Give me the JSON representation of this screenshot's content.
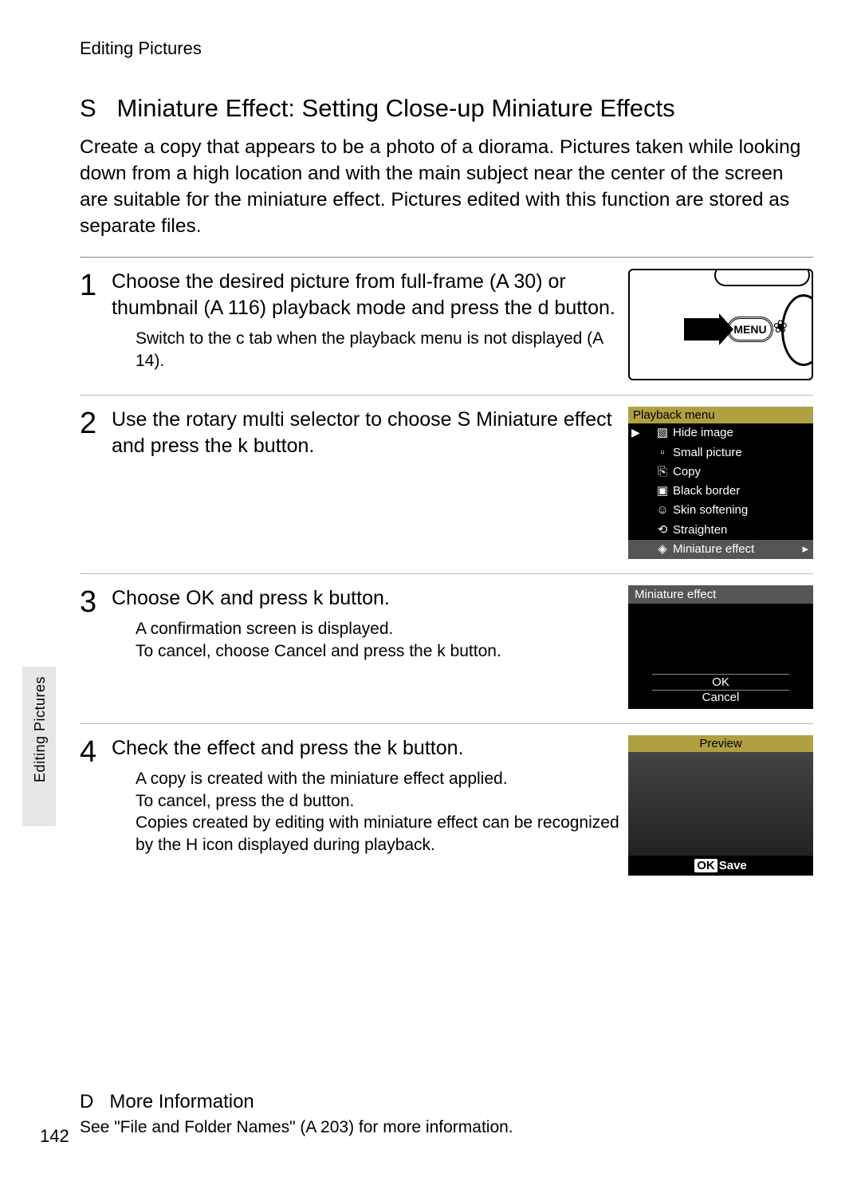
{
  "header": {
    "section": "Editing Pictures"
  },
  "side_tab": "Editing Pictures",
  "title_prefix": "S",
  "title": "Miniature Effect: Setting Close-up Miniature Effects",
  "intro": "Create a copy that appears to be a photo of a diorama. Pictures taken while looking down from a high location and with the main subject near the center of the screen are suitable for the miniature effect. Pictures edited with this function are stored as separate files.",
  "steps": [
    {
      "num": "1",
      "head": "Choose the desired picture from full-frame (A 30) or thumbnail (A 116) playback mode and press the d button.",
      "sub": "Switch to the c tab when the playback menu is not displayed (A 14).",
      "fig": "camera"
    },
    {
      "num": "2",
      "head": "Use the rotary multi selector to choose S Miniature effect and press the k button.",
      "sub": "",
      "fig": "menu"
    },
    {
      "num": "3",
      "head": "Choose OK and press k button.",
      "sub": "A confirmation screen is displayed.\nTo cancel, choose Cancel and press the k button.",
      "fig": "confirm"
    },
    {
      "num": "4",
      "head": "Check the effect and press the k button.",
      "sub": "A copy is created with the miniature effect applied.\nTo cancel, press the d button.\nCopies created by editing with miniature effect can be recognized by the H icon displayed during playback.",
      "fig": "preview"
    }
  ],
  "playback_menu": {
    "title": "Playback menu",
    "items": [
      "Hide image",
      "Small picture",
      "Copy",
      "Black border",
      "Skin softening",
      "Straighten",
      "Miniature effect"
    ],
    "selected_index": 6
  },
  "confirm_screen": {
    "title": "Miniature effect",
    "ok": "OK",
    "cancel": "Cancel"
  },
  "preview_screen": {
    "title": "Preview",
    "save": "Save",
    "ok_badge": "OK"
  },
  "camera_labels": {
    "menu": "MENU"
  },
  "footnote": {
    "icon": "D",
    "head": "More Information",
    "body": "See \"File and Folder Names\" (A 203) for more information."
  },
  "page_number": "142"
}
